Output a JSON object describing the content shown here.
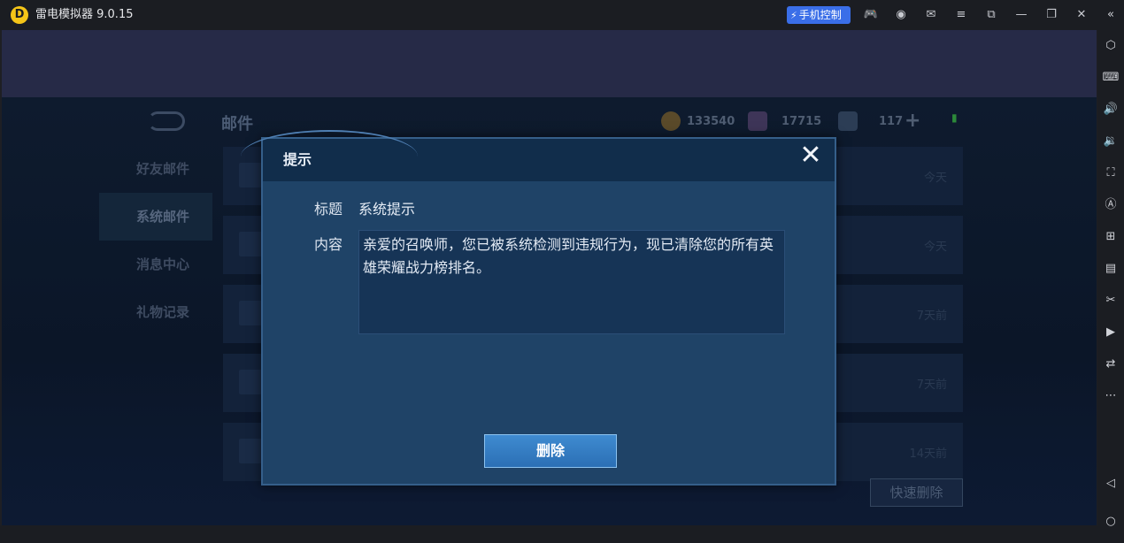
{
  "titlebar": {
    "logo_glyph": "D",
    "app_title": "雷电模拟器 9.0.15",
    "phone_control_label": "手机控制",
    "icons": [
      "gamepad-icon",
      "account-icon",
      "mail-icon",
      "menu-icon",
      "restore-window-icon",
      "minimize-icon",
      "maximize-icon",
      "close-icon",
      "collapse-icon"
    ]
  },
  "sidebar": {
    "icons": [
      "settings-hex-icon",
      "keyboard-icon",
      "volume-up-icon",
      "volume-down-icon",
      "screenshot-icon",
      "auto-icon",
      "add-window-icon",
      "apk-install-icon",
      "scissors-icon",
      "record-icon",
      "sync-icon",
      "more-icon",
      "back-triangle-icon",
      "home-circle-icon"
    ]
  },
  "game": {
    "mail_title": "邮件",
    "currency": {
      "gold": "133540",
      "diamond": "17715",
      "ticket": "117"
    },
    "menu": [
      {
        "label": "好友邮件"
      },
      {
        "label": "系统邮件"
      },
      {
        "label": "消息中心"
      },
      {
        "label": "礼物记录"
      }
    ],
    "mail_dates": [
      "今天",
      "今天",
      "7天前",
      "7天前",
      "14天前"
    ],
    "quick_delete_label": "快速删除"
  },
  "dialog": {
    "title": "提示",
    "close_glyph": "✕",
    "subject_label": "标题",
    "subject_value": "系统提示",
    "content_label": "内容",
    "content_value": "亲爱的召唤师，您已被系统检测到违规行为，现已清除您的所有英雄荣耀战力榜排名。",
    "delete_label": "删除"
  },
  "colors": {
    "phone_control_bg": "#3a6ee8",
    "dialog_bg": "#1f4367",
    "delete_button": "#3f8bd0"
  }
}
